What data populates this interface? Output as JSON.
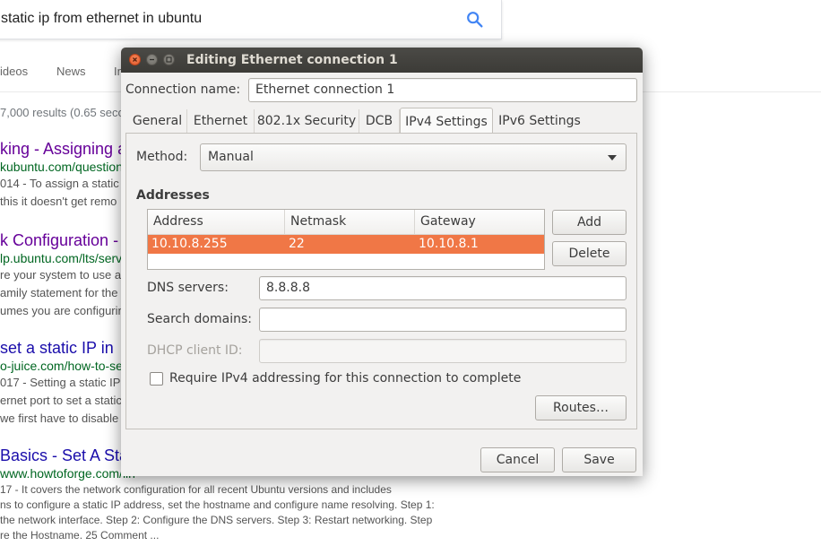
{
  "search": {
    "query": "static ip from ethernet in ubuntu",
    "nav_tabs": [
      "ideos",
      "News",
      "In"
    ],
    "results_count": "7,000 results (0.65 seco",
    "results": [
      {
        "title": "king - Assigning a",
        "url": "kubuntu.com/question",
        "snippet": [
          "014 - To assign a static",
          "this it doesn't get remo"
        ],
        "visited": true
      },
      {
        "title": "k Configuration -",
        "url": "lp.ubuntu.com/lts/serv",
        "snippet": [
          "re your system to use a",
          "amily statement for the",
          "umes you are configurin"
        ],
        "visited": true
      },
      {
        "title": "set a static IP in",
        "url": "o-juice.com/how-to-se",
        "snippet": [
          "017 - Setting a static IP",
          "ernet port to set a static",
          "we first have to disable"
        ],
        "visited": false
      },
      {
        "title": "Basics - Set A Sta",
        "url": "www.howtoforge.com/lin",
        "snippet": [
          "17 - It covers the network configuration for all recent Ubuntu versions and includes",
          "ns to configure a static IP address, set the hostname and configure name resolving. Step 1:",
          "the network interface. Step 2: Configure the DNS servers. Step 3: Restart networking. Step",
          "re the Hostname. 25 Comment ..."
        ],
        "visited": false
      }
    ]
  },
  "dialog": {
    "title": "Editing Ethernet connection 1",
    "connection_name_label": "Connection name:",
    "connection_name_value": "Ethernet connection 1",
    "tabs": [
      "General",
      "Ethernet",
      "802.1x Security",
      "DCB",
      "IPv4 Settings",
      "IPv6 Settings"
    ],
    "active_tab": "IPv4 Settings",
    "method_label": "Method:",
    "method_value": "Manual",
    "addresses_heading": "Addresses",
    "table": {
      "columns": [
        "Address",
        "Netmask",
        "Gateway"
      ],
      "rows": [
        [
          "10.10.8.255",
          "22",
          "10.10.8.1"
        ]
      ]
    },
    "add_button": "Add",
    "delete_button": "Delete",
    "dns_label": "DNS servers:",
    "dns_value": "8.8.8.8",
    "search_domains_label": "Search domains:",
    "search_domains_value": "",
    "dhcp_client_id_label": "DHCP client ID:",
    "dhcp_client_id_value": "",
    "require_ipv4_label": "Require IPv4 addressing for this connection to complete",
    "require_ipv4_checked": false,
    "routes_button": "Routes…",
    "cancel_button": "Cancel",
    "save_button": "Save"
  },
  "colors": {
    "selection": "#f07746",
    "titlebar": "#3c3b37",
    "link": "#1a0dab",
    "visited_link": "#660099",
    "url_green": "#006621"
  }
}
